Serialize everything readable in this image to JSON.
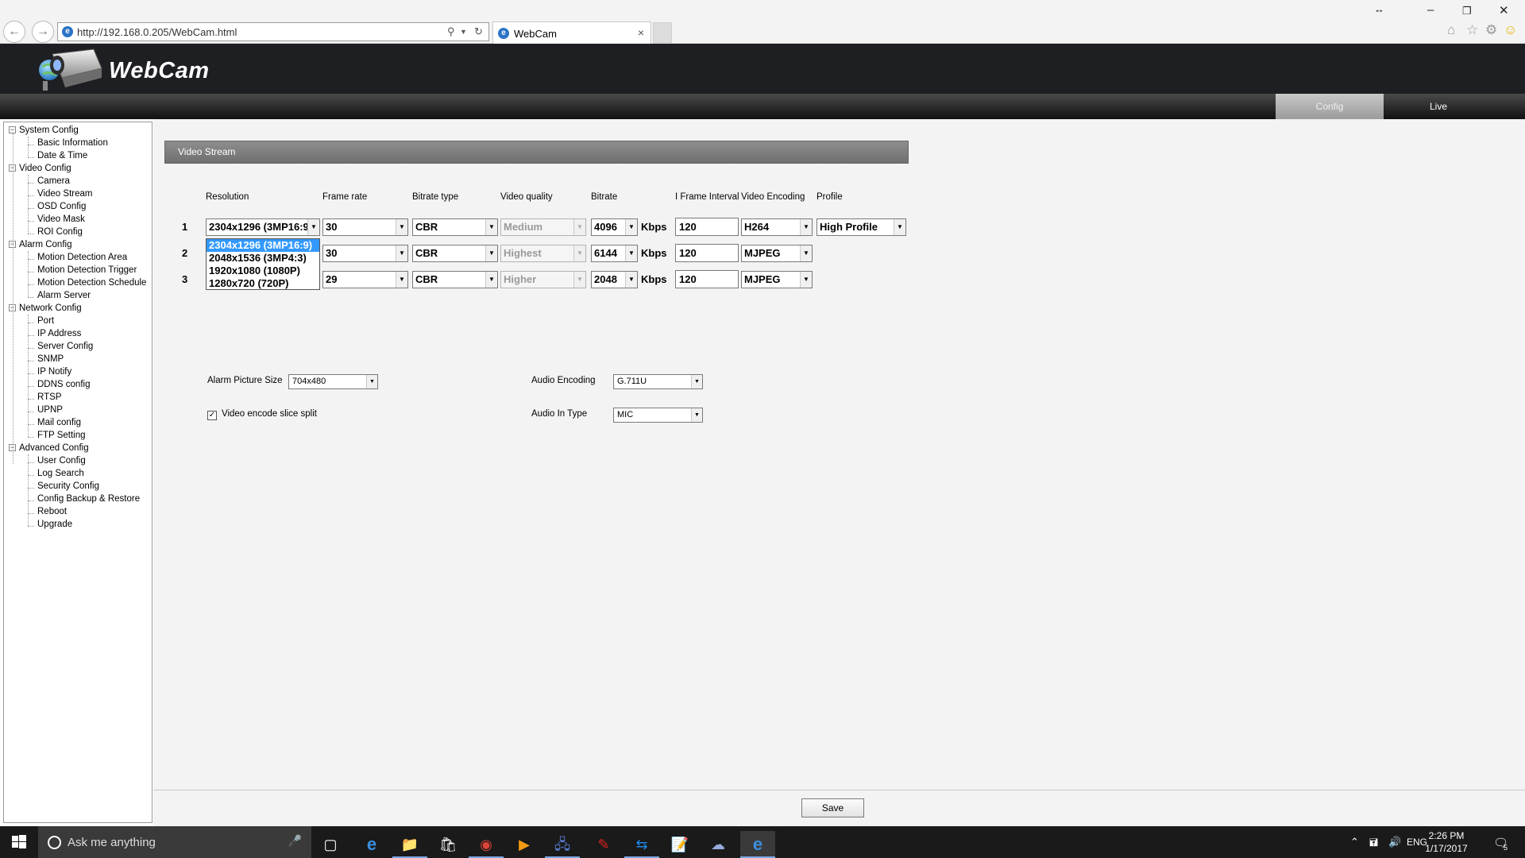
{
  "browser": {
    "url": "http://192.168.0.205/WebCam.html",
    "tab_title": "WebCam",
    "tab_close": "×"
  },
  "app": {
    "title": "WebCam",
    "menu": {
      "config": "Config",
      "live": "Live"
    }
  },
  "sidebar": {
    "groups": [
      {
        "label": "System Config",
        "items": [
          "Basic Information",
          "Date & Time"
        ]
      },
      {
        "label": "Video Config",
        "items": [
          "Camera",
          "Video Stream",
          "OSD Config",
          "Video Mask",
          "ROI Config"
        ]
      },
      {
        "label": "Alarm Config",
        "items": [
          "Motion Detection Area",
          "Motion Detection Trigger",
          "Motion Detection Schedule",
          "Alarm Server"
        ]
      },
      {
        "label": "Network Config",
        "items": [
          "Port",
          "IP Address",
          "Server Config",
          "SNMP",
          "IP Notify",
          "DDNS config",
          "RTSP",
          "UPNP",
          "Mail config",
          "FTP Setting"
        ]
      },
      {
        "label": "Advanced Config",
        "items": [
          "User Config",
          "Log Search",
          "Security Config",
          "Config Backup & Restore",
          "Reboot",
          "Upgrade"
        ]
      }
    ]
  },
  "video_stream": {
    "section_title": "Video Stream",
    "columns": {
      "resolution": "Resolution",
      "frame_rate": "Frame rate",
      "bitrate_type": "Bitrate type",
      "video_quality": "Video quality",
      "bitrate": "Bitrate",
      "iframe_interval": "I Frame Interval",
      "video_encoding": "Video Encoding",
      "profile": "Profile"
    },
    "kbps_label": "Kbps",
    "rows": [
      {
        "num": "1",
        "resolution": "2304x1296 (3MP16:9)",
        "frame_rate": "30",
        "bitrate_type": "CBR",
        "video_quality": "Medium",
        "bitrate": "4096",
        "iframe_interval": "120",
        "video_encoding": "H264",
        "profile": "High Profile"
      },
      {
        "num": "2",
        "resolution": "",
        "frame_rate": "30",
        "bitrate_type": "CBR",
        "video_quality": "Highest",
        "bitrate": "6144",
        "iframe_interval": "120",
        "video_encoding": "MJPEG",
        "profile": ""
      },
      {
        "num": "3",
        "resolution": "",
        "frame_rate": "29",
        "bitrate_type": "CBR",
        "video_quality": "Higher",
        "bitrate": "2048",
        "iframe_interval": "120",
        "video_encoding": "MJPEG",
        "profile": ""
      }
    ],
    "resolution_options": [
      "2304x1296 (3MP16:9)",
      "2048x1536 (3MP4:3)",
      "1920x1080 (1080P)",
      "1280x720 (720P)"
    ],
    "alarm_picture_size_label": "Alarm Picture Size",
    "alarm_picture_size": "704x480",
    "slice_split_label": "Video encode slice split",
    "slice_split_checked": "✓",
    "audio_encoding_label": "Audio Encoding",
    "audio_encoding": "G.711U",
    "audio_in_type_label": "Audio In Type",
    "audio_in_type": "MIC",
    "save_label": "Save"
  },
  "taskbar": {
    "search_placeholder": "Ask me anything",
    "language": "ENG",
    "time": "2:26 PM",
    "date": "1/17/2017",
    "notification_count": "5"
  },
  "colors": {
    "header_bg": "#1e1f22",
    "section_header": "#7d7d7d",
    "selection_blue": "#3399ff",
    "active_tab": "#b0b0b0"
  }
}
